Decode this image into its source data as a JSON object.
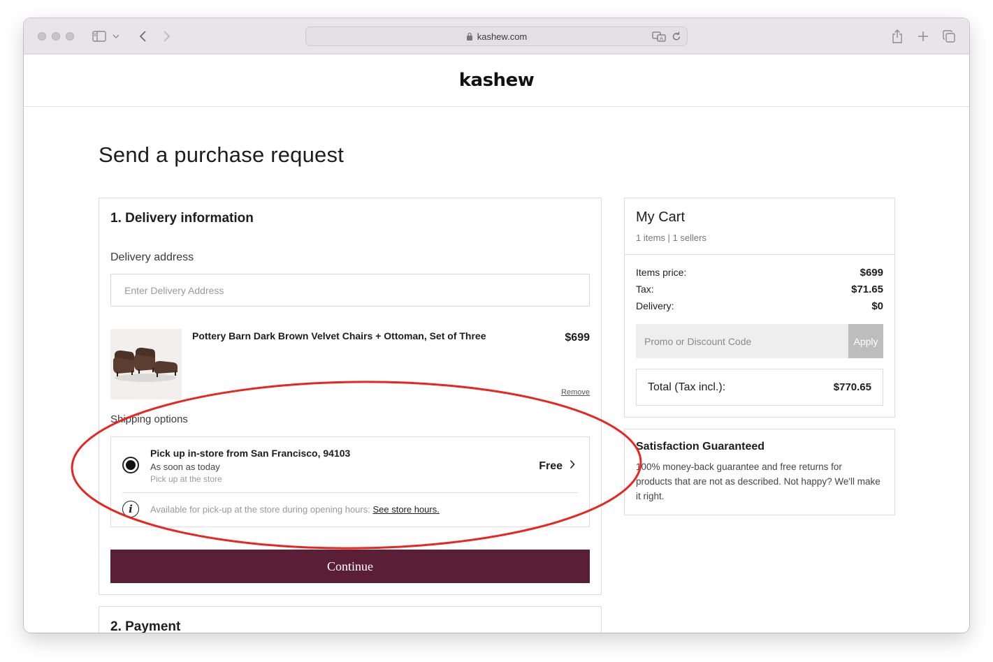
{
  "browser": {
    "url": "kashew.com"
  },
  "site": {
    "logo": "kashew"
  },
  "page": {
    "title": "Send a purchase request"
  },
  "delivery": {
    "section_title": "1. Delivery information",
    "address_label": "Delivery address",
    "address_placeholder": "Enter Delivery Address",
    "address_value": "",
    "product": {
      "name": "Pottery Barn Dark Brown Velvet Chairs + Ottoman, Set of Three",
      "price": "$699",
      "remove_label": "Remove"
    },
    "shipping_label": "Shipping options",
    "shipping_option": {
      "title": "Pick up in-store from San Francisco, 94103",
      "timing": "As soon as today",
      "method": "Pick up at the store",
      "price": "Free",
      "selected": true
    },
    "info_text": "Available for pick-up at the store during opening hours: ",
    "info_link": "See store hours.",
    "continue_label": "Continue"
  },
  "payment": {
    "section_title": "2. Payment"
  },
  "cart": {
    "title": "My Cart",
    "subtitle": "1 items | 1 sellers",
    "items_price_label": "Items price:",
    "items_price_value": "$699",
    "tax_label": "Tax:",
    "tax_value": "$71.65",
    "delivery_label": "Delivery:",
    "delivery_value": "$0",
    "promo_placeholder": "Promo or Discount Code",
    "apply_label": "Apply",
    "total_label": "Total (Tax incl.):",
    "total_value": "$770.65"
  },
  "guarantee": {
    "title": "Satisfaction Guaranteed",
    "text": "100% money-back guarantee and free returns for products that are not as described. Not happy? We'll make it right."
  },
  "colors": {
    "primary_button": "#5a1f37",
    "annotation": "#e8261e",
    "apply_button": "#bdbdbd"
  }
}
